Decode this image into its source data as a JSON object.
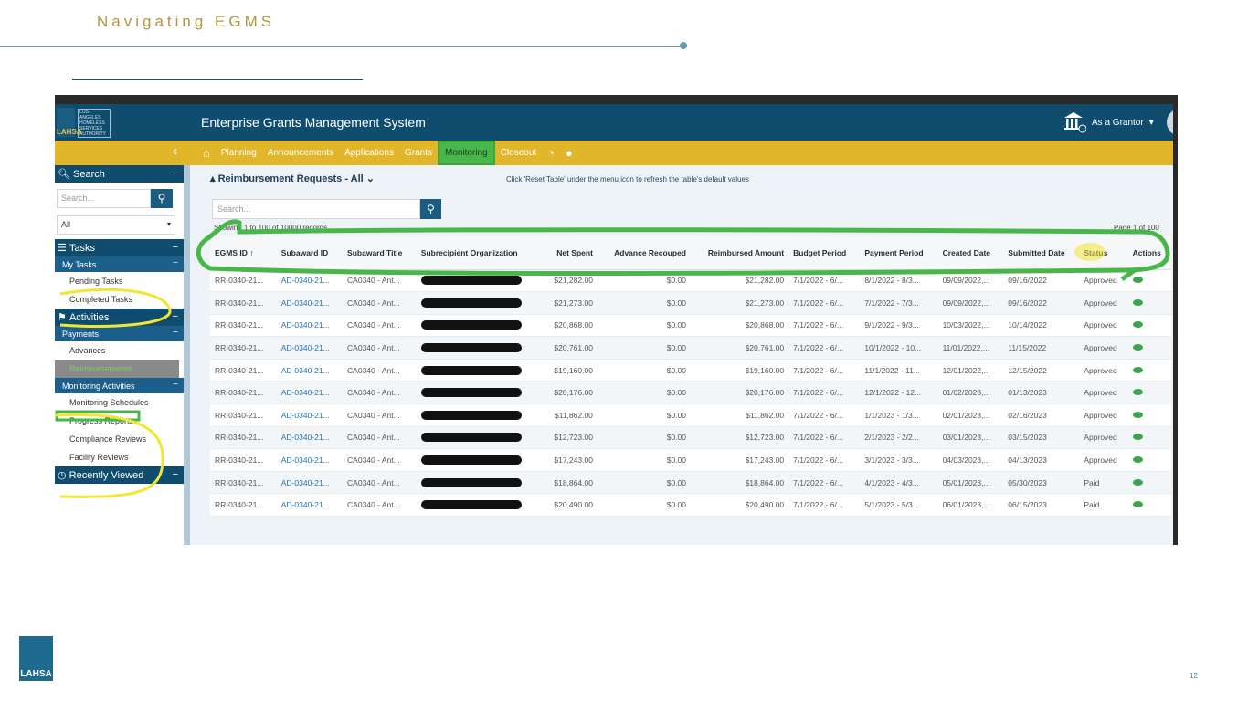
{
  "slide": {
    "title": "Navigating EGMS",
    "page_number": "12",
    "footer_logo": "LAHSA"
  },
  "app": {
    "title": "Enterprise Grants Management System",
    "role_menu": "As a Grantor",
    "logo_text": "LAHSA",
    "logo_lines": [
      "LOS ANGELES",
      "HOMELESS",
      "SERVICES",
      "AUTHORITY"
    ]
  },
  "nav": {
    "items": [
      "Planning",
      "Announcements",
      "Applications",
      "Grants",
      "Monitoring",
      "Closeout"
    ],
    "active": "Monitoring"
  },
  "sidebar": {
    "search_header": "Search",
    "search_placeholder": "Search...",
    "select_value": "All",
    "tasks_header": "Tasks",
    "my_tasks": "My Tasks",
    "pending_tasks": "Pending Tasks",
    "completed_tasks": "Completed Tasks",
    "activities_header": "Activities",
    "payments": "Payments",
    "advances": "Advances",
    "reimbursements": "Reimbursements",
    "monitoring_activities": "Monitoring Activities",
    "monitoring_schedules": "Monitoring Schedules",
    "progress_reports": "Progress Reports",
    "compliance_reviews": "Compliance Reviews",
    "facility_reviews": "Facility Reviews",
    "recently_viewed": "Recently Viewed"
  },
  "main": {
    "header": "Reimbursement Requests - All",
    "hint": "Click 'Reset Table' under the menu icon to refresh the table's default values",
    "search_placeholder": "Search...",
    "showing": "Showing 1 to 100 of 10000 records",
    "page_info": "Page 1 of 100",
    "columns": [
      "EGMS ID",
      "Subaward ID",
      "Subaward Title",
      "Subrecipient Organization",
      "Net Spent",
      "Advance Recouped",
      "Reimbursed Amount",
      "Budget Period",
      "Payment Period",
      "Created Date",
      "Submitted Date",
      "Status",
      "Actions"
    ],
    "rows": [
      {
        "egms": "RR-0340-21...",
        "subaward": "AD-0340-21...",
        "title": "CA0340 - Ant...",
        "org": "",
        "net": "$21,282.00",
        "adv": "$0.00",
        "reimb": "$21,282.00",
        "budget": "7/1/2022 - 6/...",
        "payment": "8/1/2022 - 8/3...",
        "created": "09/09/2022,...",
        "submitted": "09/16/2022",
        "status": "Approved"
      },
      {
        "egms": "RR-0340-21...",
        "subaward": "AD-0340-21...",
        "title": "CA0340 - Ant...",
        "org": "",
        "net": "$21,273.00",
        "adv": "$0.00",
        "reimb": "$21,273.00",
        "budget": "7/1/2022 - 6/...",
        "payment": "7/1/2022 - 7/3...",
        "created": "09/09/2022,...",
        "submitted": "09/16/2022",
        "status": "Approved"
      },
      {
        "egms": "RR-0340-21...",
        "subaward": "AD-0340-21...",
        "title": "CA0340 - Ant...",
        "org": "",
        "net": "$20,868.00",
        "adv": "$0.00",
        "reimb": "$20,868.00",
        "budget": "7/1/2022 - 6/...",
        "payment": "9/1/2022 - 9/3...",
        "created": "10/03/2022,...",
        "submitted": "10/14/2022",
        "status": "Approved"
      },
      {
        "egms": "RR-0340-21...",
        "subaward": "AD-0340-21...",
        "title": "CA0340 - Ant...",
        "org": "",
        "net": "$20,761.00",
        "adv": "$0.00",
        "reimb": "$20,761.00",
        "budget": "7/1/2022 - 6/...",
        "payment": "10/1/2022 - 10...",
        "created": "11/01/2022,...",
        "submitted": "11/15/2022",
        "status": "Approved"
      },
      {
        "egms": "RR-0340-21...",
        "subaward": "AD-0340-21...",
        "title": "CA0340 - Ant...",
        "org": "",
        "net": "$19,160.00",
        "adv": "$0.00",
        "reimb": "$19,160.00",
        "budget": "7/1/2022 - 6/...",
        "payment": "11/1/2022 - 11...",
        "created": "12/01/2022,...",
        "submitted": "12/15/2022",
        "status": "Approved"
      },
      {
        "egms": "RR-0340-21...",
        "subaward": "AD-0340-21...",
        "title": "CA0340 - Ant...",
        "org": "",
        "net": "$20,176.00",
        "adv": "$0.00",
        "reimb": "$20,176.00",
        "budget": "7/1/2022 - 6/...",
        "payment": "12/1/2022 - 12...",
        "created": "01/02/2023,...",
        "submitted": "01/13/2023",
        "status": "Approved"
      },
      {
        "egms": "RR-0340-21...",
        "subaward": "AD-0340-21...",
        "title": "CA0340 - Ant...",
        "org": "",
        "net": "$11,862.00",
        "adv": "$0.00",
        "reimb": "$11,862.00",
        "budget": "7/1/2022 - 6/...",
        "payment": "1/1/2023 - 1/3...",
        "created": "02/01/2023,...",
        "submitted": "02/16/2023",
        "status": "Approved"
      },
      {
        "egms": "RR-0340-21...",
        "subaward": "AD-0340-21...",
        "title": "CA0340 - Ant...",
        "org": "",
        "net": "$12,723.00",
        "adv": "$0.00",
        "reimb": "$12,723.00",
        "budget": "7/1/2022 - 6/...",
        "payment": "2/1/2023 - 2/2...",
        "created": "03/01/2023,...",
        "submitted": "03/15/2023",
        "status": "Approved"
      },
      {
        "egms": "RR-0340-21...",
        "subaward": "AD-0340-21...",
        "title": "CA0340 - Ant...",
        "org": "",
        "net": "$17,243.00",
        "adv": "$0.00",
        "reimb": "$17,243.00",
        "budget": "7/1/2022 - 6/...",
        "payment": "3/1/2023 - 3/3...",
        "created": "04/03/2023,...",
        "submitted": "04/13/2023",
        "status": "Approved"
      },
      {
        "egms": "RR-0340-21...",
        "subaward": "AD-0340-21...",
        "title": "CA0340 - Ant...",
        "org": "",
        "net": "$18,864.00",
        "adv": "$0.00",
        "reimb": "$18,864.00",
        "budget": "7/1/2022 - 6/...",
        "payment": "4/1/2023 - 4/3...",
        "created": "05/01/2023,...",
        "submitted": "05/30/2023",
        "status": "Paid"
      },
      {
        "egms": "RR-0340-21...",
        "subaward": "AD-0340-21...",
        "title": "CA0340 - Ant...",
        "org": "",
        "net": "$20,490.00",
        "adv": "$0.00",
        "reimb": "$20,490.00",
        "budget": "7/1/2022 - 6/...",
        "payment": "5/1/2023 - 5/3...",
        "created": "06/01/2023,...",
        "submitted": "06/15/2023",
        "status": "Paid"
      }
    ]
  },
  "colors": {
    "header_blue": "#0f4c6e",
    "nav_gold": "#e2b62b",
    "highlight_green": "#49b649",
    "highlight_yellow": "#f2e634",
    "title_gold": "#b39442"
  }
}
